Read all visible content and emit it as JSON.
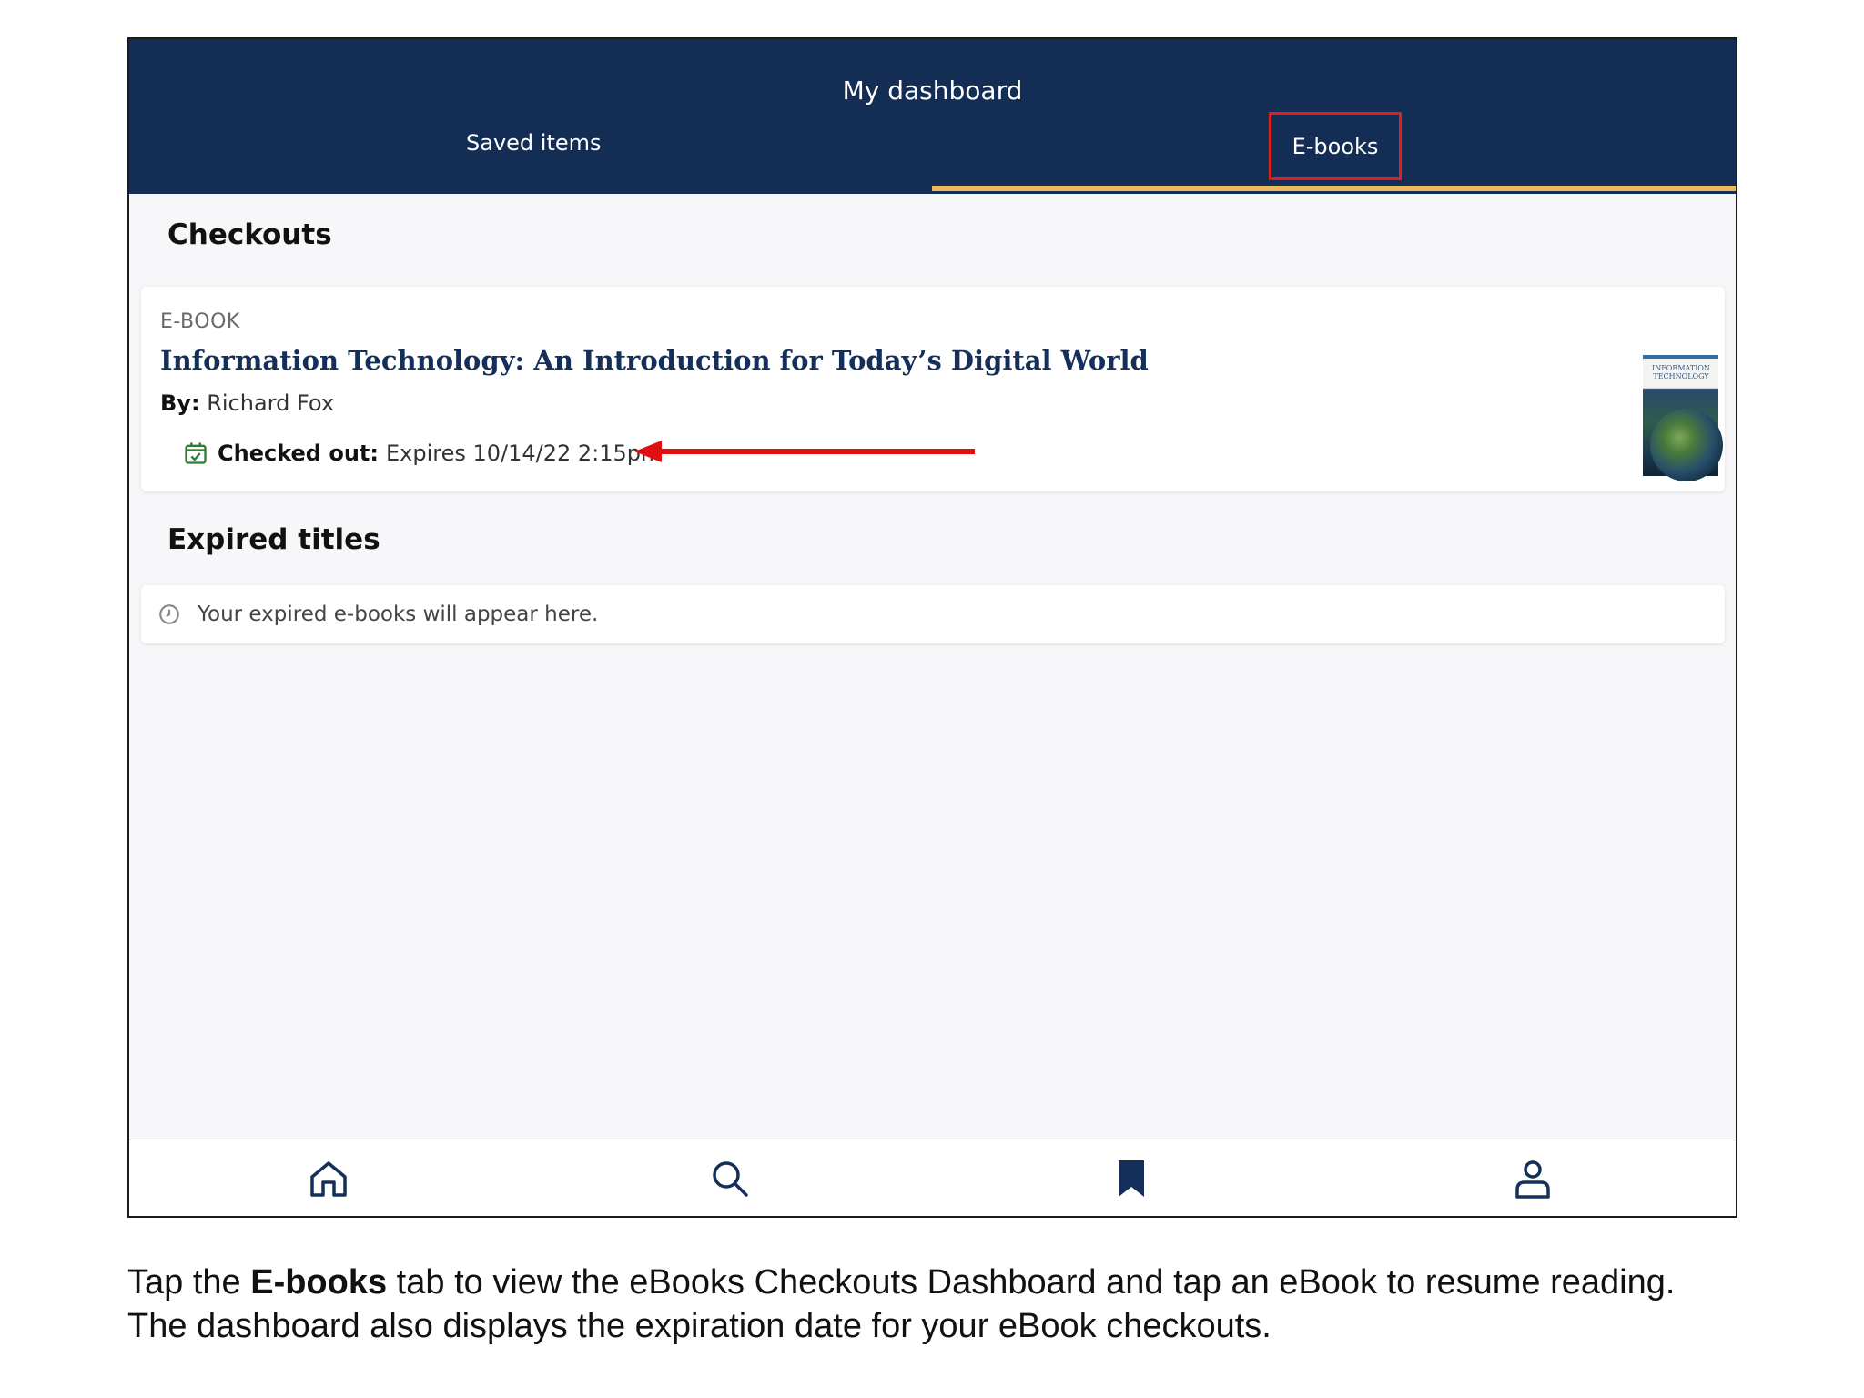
{
  "header": {
    "title": "My dashboard",
    "tabs": [
      {
        "label": "Saved items",
        "active": false
      },
      {
        "label": "E-books",
        "active": true
      }
    ]
  },
  "checkouts": {
    "section_title": "Checkouts",
    "item": {
      "type": "E-BOOK",
      "title": "Information Technology: An Introduction for Today’s Digital World",
      "by_label": "By:",
      "author": "Richard Fox",
      "status_label": "Checked out:",
      "status_value": "Expires 10/14/22 2:15pm",
      "cover_text": "INFORMATION TECHNOLOGY"
    }
  },
  "expired": {
    "section_title": "Expired titles",
    "empty_message": "Your expired e-books will appear here."
  },
  "bottom_nav": {
    "items": [
      "home-icon",
      "search-icon",
      "bookmark-icon",
      "profile-icon"
    ]
  },
  "caption": {
    "part1": "Tap the ",
    "bold": "E-books",
    "part2": " tab to view the eBooks Checkouts Dashboard and tap an eBook to resume reading.",
    "line2": "The dashboard also displays the expiration date for your eBook checkouts."
  },
  "colors": {
    "header_bg": "#132d55",
    "tab_underline": "#e8b85a",
    "highlight_box": "#e02020",
    "title_color": "#14305a",
    "check_icon": "#2e7d32"
  }
}
